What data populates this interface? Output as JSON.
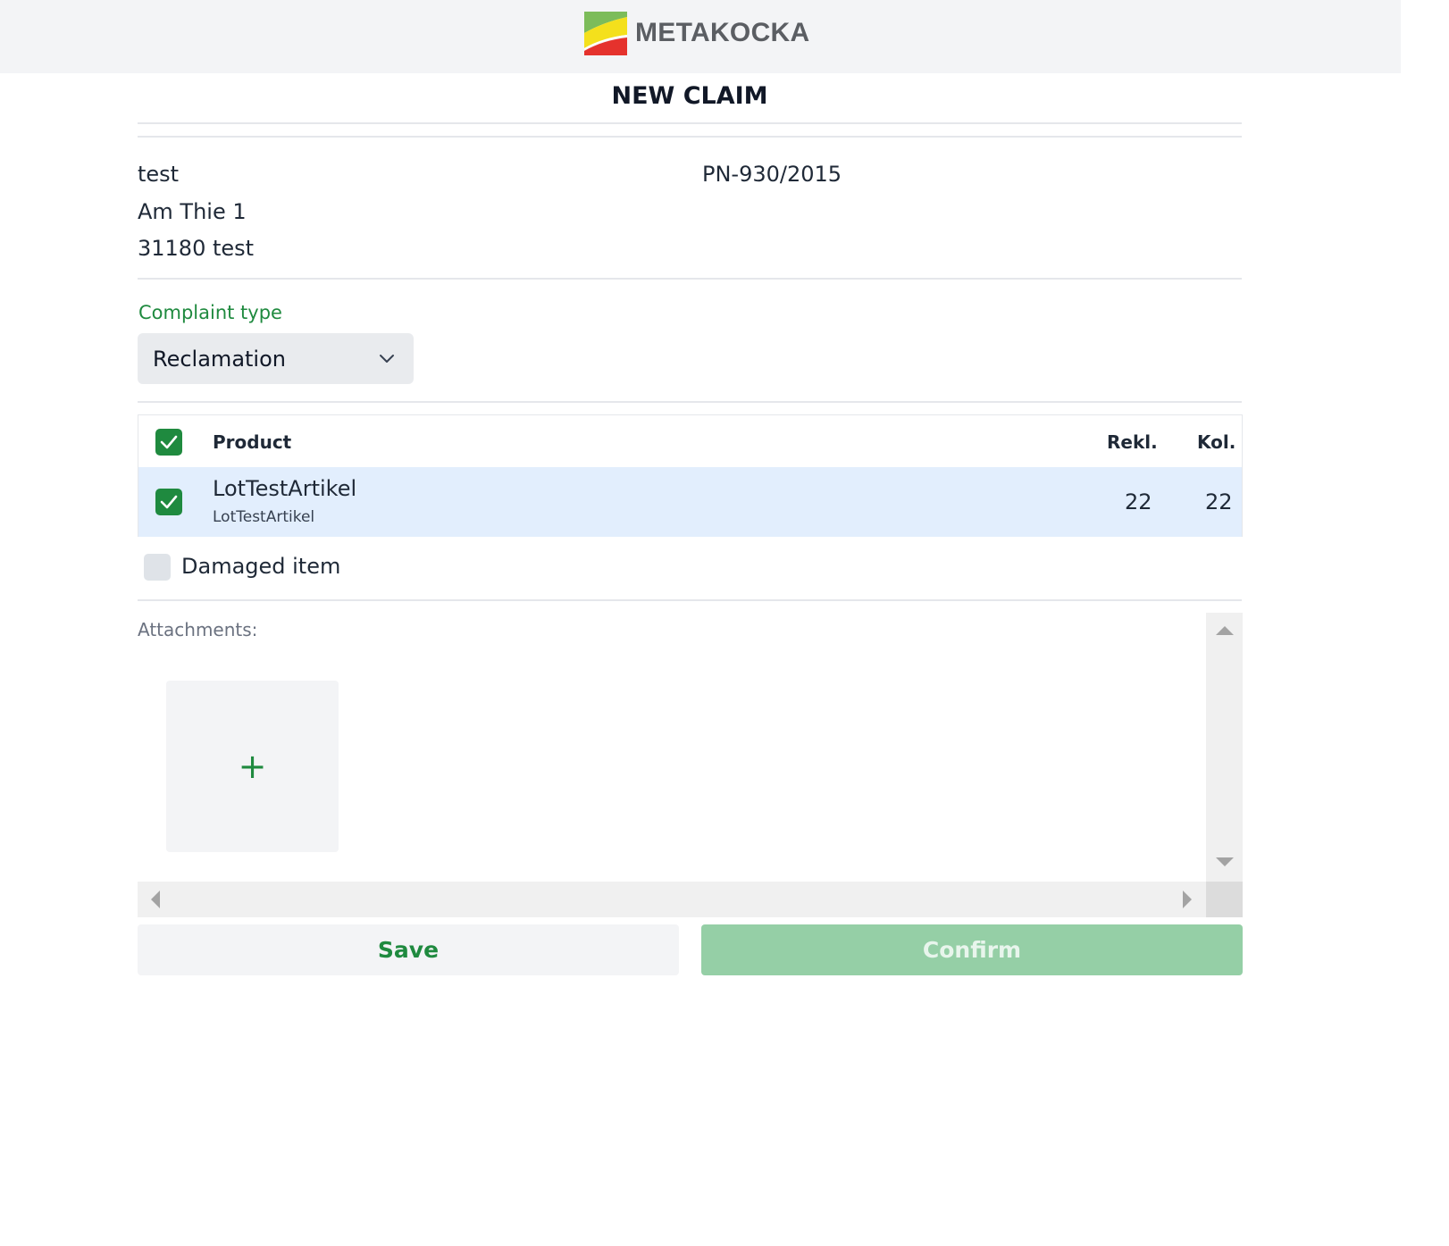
{
  "header": {
    "brand": "METAKOCKA",
    "logo_icon": "metakocka-logo-icon",
    "logo_colors": {
      "top": "#7cbc5a",
      "middle": "#f4e01c",
      "bottom": "#e5322d"
    }
  },
  "page": {
    "title": "NEW CLAIM"
  },
  "customer": {
    "name": "test",
    "street": "Am Thie 1",
    "city": "31180 test",
    "document_number": "PN-930/2015"
  },
  "complaint_type": {
    "label": "Complaint type",
    "selected": "Reclamation"
  },
  "table": {
    "header": {
      "select_all_checked": true,
      "product_label": "Product",
      "rekl_label": "Rekl.",
      "kol_label": "Kol."
    },
    "rows": [
      {
        "checked": true,
        "name": "LotTestArtikel",
        "code": "LotTestArtikel",
        "rekl": "22",
        "kol": "22"
      }
    ]
  },
  "damaged": {
    "label": "Damaged item",
    "checked": false
  },
  "attachments": {
    "label": "Attachments:",
    "add_symbol": "+"
  },
  "actions": {
    "save_label": "Save",
    "confirm_label": "Confirm"
  },
  "colors": {
    "accent": "#1f8a3f",
    "confirm_disabled": "#95cfa6",
    "row_highlight": "#e2eefd"
  }
}
